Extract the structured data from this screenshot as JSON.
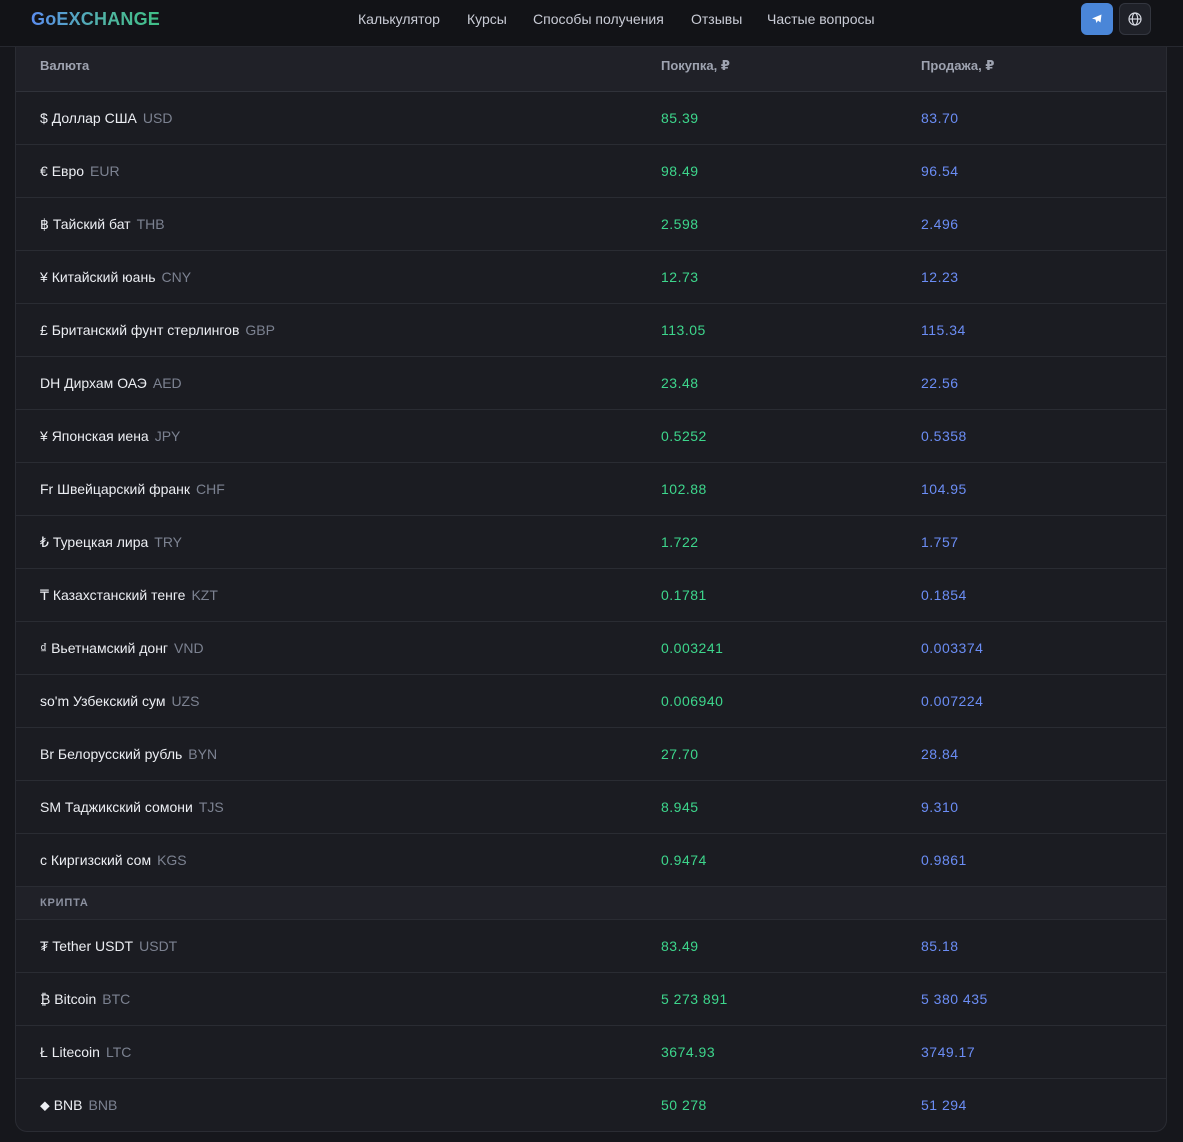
{
  "header": {
    "logo": "GoEXCHANGE",
    "nav": [
      "Калькулятор",
      "Курсы",
      "Способы получения",
      "Отзывы",
      "Частые вопросы"
    ],
    "telegram_icon": "telegram-icon",
    "language_icon": "globe-icon"
  },
  "table": {
    "columns": {
      "currency": "Валюта",
      "buy": "Покупка, ₽",
      "sell": "Продажа, ₽"
    },
    "rows": [
      {
        "symbol": "$",
        "name": "Доллар США",
        "code": "USD",
        "buy": "85.39",
        "sell": "83.70"
      },
      {
        "symbol": "€",
        "name": "Евро",
        "code": "EUR",
        "buy": "98.49",
        "sell": "96.54"
      },
      {
        "symbol": "฿",
        "name": "Тайский бат",
        "code": "THB",
        "buy": "2.598",
        "sell": "2.496"
      },
      {
        "symbol": "¥",
        "name": "Китайский юань",
        "code": "CNY",
        "buy": "12.73",
        "sell": "12.23"
      },
      {
        "symbol": "£",
        "name": "Британский фунт стерлингов",
        "code": "GBP",
        "buy": "113.05",
        "sell": "115.34"
      },
      {
        "symbol": "DH",
        "name": "Дирхам ОАЭ",
        "code": "AED",
        "buy": "23.48",
        "sell": "22.56"
      },
      {
        "symbol": "¥",
        "name": "Японская иена",
        "code": "JPY",
        "buy": "0.5252",
        "sell": "0.5358"
      },
      {
        "symbol": "Fr",
        "name": "Швейцарский франк",
        "code": "CHF",
        "buy": "102.88",
        "sell": "104.95"
      },
      {
        "symbol": "₺",
        "name": "Турецкая лира",
        "code": "TRY",
        "buy": "1.722",
        "sell": "1.757"
      },
      {
        "symbol": "₸",
        "name": "Казахстанский тенге",
        "code": "KZT",
        "buy": "0.1781",
        "sell": "0.1854"
      },
      {
        "symbol": "₫",
        "name": "Вьетнамский донг",
        "code": "VND",
        "buy": "0.003241",
        "sell": "0.003374"
      },
      {
        "symbol": "so'm",
        "name": "Узбекский сум",
        "code": "UZS",
        "buy": "0.006940",
        "sell": "0.007224"
      },
      {
        "symbol": "Br",
        "name": "Белорусский рубль",
        "code": "BYN",
        "buy": "27.70",
        "sell": "28.84"
      },
      {
        "symbol": "SM",
        "name": "Таджикский сомони",
        "code": "TJS",
        "buy": "8.945",
        "sell": "9.310"
      },
      {
        "symbol": "с",
        "name": "Киргизский сом",
        "code": "KGS",
        "buy": "0.9474",
        "sell": "0.9861"
      }
    ],
    "crypto_section": "КРИПТА",
    "crypto_rows": [
      {
        "symbol": "₮",
        "name": "Tether USDT",
        "code": "USDT",
        "buy": "83.49",
        "sell": "85.18"
      },
      {
        "symbol": "₿",
        "name": "Bitcoin",
        "code": "BTC",
        "buy": "5 273 891",
        "sell": "5 380 435"
      },
      {
        "symbol": "Ł",
        "name": "Litecoin",
        "code": "LTC",
        "buy": "3674.93",
        "sell": "3749.17"
      },
      {
        "symbol": "⬥",
        "name": "BNB",
        "code": "BNB",
        "buy": "50 278",
        "sell": "51 294"
      }
    ]
  },
  "colors": {
    "buy": "#3dd68c",
    "sell": "#6b8df5",
    "accent": "#4a86d8"
  }
}
